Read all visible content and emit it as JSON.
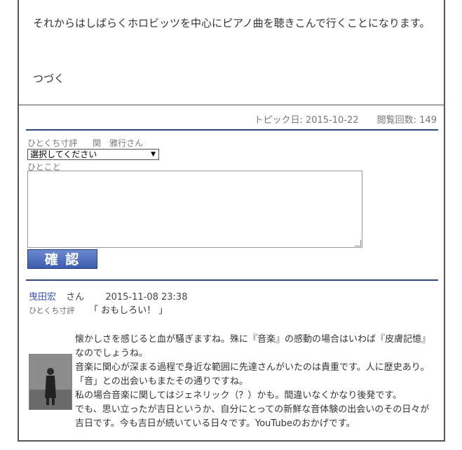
{
  "article": {
    "paragraph": "それからはしばらくホロビッツを中心にピアノ曲を聴きこんで行くことになります。",
    "ending": "つづく"
  },
  "topic_meta": {
    "topic_date": "トピック日: 2015-10-22",
    "view_count": "閲覧回数: 149"
  },
  "comment_form": {
    "header_label": "ひとくち寸評",
    "author_name": "関　雅行さん",
    "select_value": "選択してください",
    "textarea_label": "ひとこと",
    "textarea_value": "",
    "confirm_label": "確 認"
  },
  "comment": {
    "author": "曳田宏",
    "author_suffix": "さん",
    "date": "2015-11-08 23:38",
    "tag_label": "ひとくち寸評",
    "quote": "「 おもしろい！ 」",
    "body_lines": [
      "懐かしさを感じると血が騒ぎますね。殊に『音楽』の感動の場合はいわば『皮膚記憶』なのでしょうね。",
      "音楽に関心が深まる過程で身近な範囲に先達さんがいたのは貴重です。人に歴史あり。「音」との出会いもまたその通りですね。",
      "私の場合音楽に関してはジェネリック（？）かも。間違いなくかなり後発です。",
      "でも、思い立ったが吉日というか、自分にとっての新鮮な音体験の出会いのその日々が吉日です。今も吉日が続いている日々です。YouTubeのおかげです。"
    ]
  },
  "colors": {
    "rule": "#2f4a7a",
    "author_link": "#3a52b0",
    "button": "#3b5cae"
  }
}
